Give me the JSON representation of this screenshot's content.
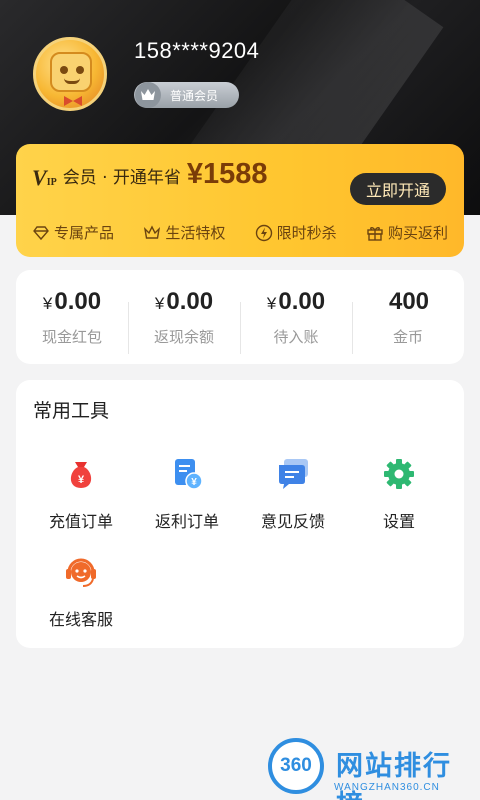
{
  "profile": {
    "phone": "158****9204",
    "member_level": "普通会员"
  },
  "vip": {
    "logo": "V",
    "logo_sub": "IP",
    "promo_text": "会员 · 开通年省",
    "price": "¥1588",
    "open_button": "立即开通",
    "perks": [
      {
        "label": "专属产品",
        "icon": "diamond-icon"
      },
      {
        "label": "生活特权",
        "icon": "crown-icon"
      },
      {
        "label": "限时秒杀",
        "icon": "lightning-icon"
      },
      {
        "label": "购买返利",
        "icon": "gift-icon"
      }
    ]
  },
  "stats": [
    {
      "currency": "¥",
      "value": "0.00",
      "label": "现金红包"
    },
    {
      "currency": "¥",
      "value": "0.00",
      "label": "返现余额"
    },
    {
      "currency": "¥",
      "value": "0.00",
      "label": "待入账"
    },
    {
      "currency": "",
      "value": "400",
      "label": "金币"
    }
  ],
  "tools": {
    "title": "常用工具",
    "items": [
      {
        "label": "充值订单",
        "icon": "money-bag-icon"
      },
      {
        "label": "返利订单",
        "icon": "rebate-doc-icon"
      },
      {
        "label": "意见反馈",
        "icon": "feedback-chat-icon"
      },
      {
        "label": "设置",
        "icon": "gear-icon"
      },
      {
        "label": "在线客服",
        "icon": "headset-icon"
      }
    ]
  },
  "watermark": {
    "logo": "360",
    "title": "网站排行榜",
    "url": "WANGZHAN360.CN"
  },
  "colors": {
    "vip_gold": "#ffc62f",
    "price_brown": "#7a3c08",
    "accent_blue": "#2f8ee0",
    "red": "#f0413d",
    "green": "#2eb872"
  }
}
